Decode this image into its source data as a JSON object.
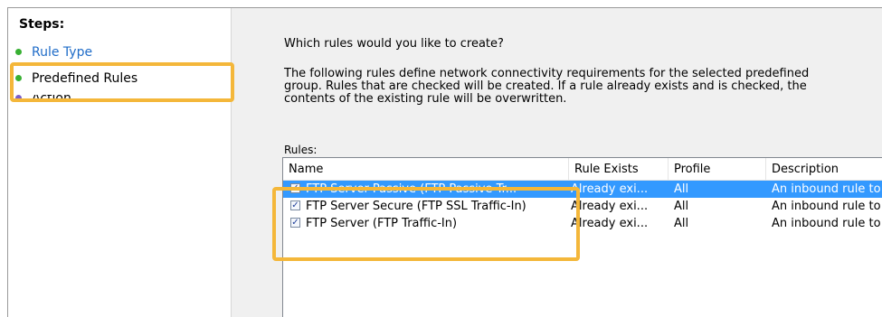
{
  "steps": {
    "title": "Steps:",
    "items": [
      {
        "label": "Rule Type",
        "dot_color": "#38b033"
      },
      {
        "label": "Predefined Rules",
        "dot_color": "#38b033"
      },
      {
        "label": "Action",
        "dot_color": "#7b5fc6"
      }
    ]
  },
  "main": {
    "question": "Which rules would you like to create?",
    "description_line1": "The following rules define network connectivity requirements for the selected predefined",
    "description_line2": "group. Rules that are checked will be created. If a rule already exists and is checked, the",
    "description_line3": "contents of the existing rule will be overwritten.",
    "rules_label": "Rules:"
  },
  "table": {
    "columns": [
      "Name",
      "Rule Exists",
      "Profile",
      "Description"
    ],
    "rows": [
      {
        "checked": true,
        "name": "FTP Server Passive (FTP Passive Tr...",
        "exists": "Already exi...",
        "profile": "All",
        "description": "An inbound rule to",
        "selected": true
      },
      {
        "checked": true,
        "name": "FTP Server Secure (FTP SSL Traffic-In)",
        "exists": "Already exi...",
        "profile": "All",
        "description": "An inbound rule to",
        "selected": false
      },
      {
        "checked": true,
        "name": "FTP Server (FTP Traffic-In)",
        "exists": "Already exi...",
        "profile": "All",
        "description": "An inbound rule to",
        "selected": false
      }
    ],
    "check_mark": "✓"
  },
  "colors": {
    "highlight": "#f4b73a",
    "selection": "#3399ff",
    "link": "#1f6cc8"
  }
}
